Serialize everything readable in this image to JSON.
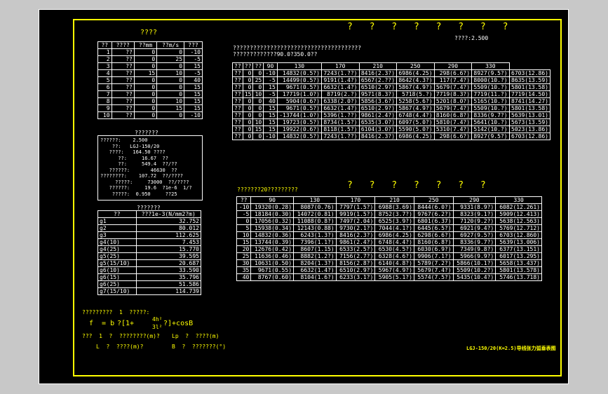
{
  "header": {
    "left_title": "????",
    "main_title": "? ? ? ? ? ? ? ?",
    "safety_note": "????:2.500",
    "subtitle": "??????????????????????????????????????\n?????????????90.0?350.0??",
    "second_title": "? ? ? ? ? ? ?",
    "second_subtitle": "???????20?????????",
    "stamp": "LGJ-150/20(K=2.5)导线张力弧垂表图"
  },
  "conditions_table": {
    "headers": [
      "??",
      "????",
      "??mm",
      "??m/s",
      "???"
    ],
    "rows": [
      [
        "1",
        "??",
        "0",
        "0",
        "-10"
      ],
      [
        "2",
        "??",
        "0",
        "25",
        "-5"
      ],
      [
        "3",
        "??",
        "0",
        "0",
        "15"
      ],
      [
        "4",
        "??",
        "15",
        "10",
        "-5"
      ],
      [
        "5",
        "??",
        "0",
        "0",
        "40"
      ],
      [
        "6",
        "??",
        "0",
        "0",
        "15"
      ],
      [
        "7",
        "??",
        "0",
        "0",
        "15"
      ],
      [
        "8",
        "??",
        "0",
        "10",
        "15"
      ],
      [
        "9",
        "??",
        "0",
        "15",
        "15"
      ],
      [
        "10",
        "??",
        "0",
        "0",
        "-10"
      ]
    ]
  },
  "params_box": {
    "title": "???????",
    "lines": [
      "??????:    2.500",
      "    ??:   LGJ-150/20",
      "   ????:   164.50 ????",
      "      ??:     16.67  ??",
      "      ??:     549.4  ??/??",
      "   ??????:       46630  ??",
      "????????:    107.72  ??/????",
      "     ?????:     73000  ??/????",
      "   ??????:     19.6  ?1e-6  1/?",
      "    ?????:  0.950     ??25"
    ]
  },
  "load_table": {
    "title": "???????",
    "headers": [
      "??",
      "???1e-3(N/mm2?m)"
    ],
    "rows": [
      [
        "g1",
        "32.752"
      ],
      [
        "g2",
        "80.012"
      ],
      [
        "g3",
        "112.625"
      ],
      [
        "g4(10)",
        "7.453"
      ],
      [
        "g4(25)",
        "15.770"
      ],
      [
        "g5(25)",
        "39.595"
      ],
      [
        "g5(15/10)",
        "20.687"
      ],
      [
        "g6(10)",
        "33.590"
      ],
      [
        "g6(15)",
        "35.796"
      ],
      [
        "g6(25)",
        "51.586"
      ],
      [
        "g7(15/10)",
        "114.739"
      ]
    ]
  },
  "tension_table": {
    "headers": [
      "??",
      "??",
      "??",
      "90",
      "130",
      "170",
      "210",
      "250",
      "290",
      "330"
    ],
    "rows": [
      [
        "??",
        "0",
        "0",
        "-10",
        "14832(0.5?)",
        "7243(1.??)",
        "8416(2.3?)",
        "6986(4.25)",
        "298(6.6?)",
        "8927(9.5?)",
        "6703(12.86)"
      ],
      [
        "??",
        "0",
        "25",
        "-5",
        "14499(0.5?)",
        "9191(1.4?)",
        "6567(2.??)",
        "8642(4.3?)",
        "117(7.4?)",
        "8000(10.?)",
        "8635(13.59)"
      ],
      [
        "??",
        "0",
        "0",
        "15",
        "9671(0.5?)",
        "6632(1.4?)",
        "6510(2.9?)",
        "5867(4.9?)",
        "5679(7.4?)",
        "5509(10.?)",
        "5801(13.58)"
      ],
      [
        "??",
        "15",
        "10",
        "-5",
        "17719(1.0?)",
        "8719(2.?)",
        "9571(8.3?)",
        "5718(5.?)",
        "7719(8.3?)",
        "7719(11.?)",
        "7719(14.50)"
      ],
      [
        "??",
        "0",
        "0",
        "40",
        "5904(0.6?)",
        "6338(2.0?)",
        "5856(3.6?)",
        "5258(5.6?)",
        "5201(8.0?)",
        "5165(10.?)",
        "8741(14.27)"
      ],
      [
        "??",
        "0",
        "0",
        "15",
        "9671(0.5?)",
        "6632(1.4?)",
        "6510(2.9?)",
        "5867(4.9?)",
        "5679(7.4?)",
        "5509(10.?)",
        "5801(13.58)"
      ],
      [
        "??",
        "0",
        "0",
        "15",
        "-13744(1.0?)",
        "5396(1.??)",
        "9861(2.4?)",
        "6748(4.4?)",
        "8160(6.8?)",
        "8336(9.7?)",
        "5639(13.01)"
      ],
      [
        "??",
        "0",
        "10",
        "15",
        "19723(0.5?)",
        "8734(1.5?)",
        "6535(3.0?)",
        "6097(5.0?)",
        "5810(7.4?)",
        "5641(10.?)",
        "5673(13.59)"
      ],
      [
        "??",
        "0",
        "15",
        "15",
        "19922(0.6?)",
        "8118(1.5?)",
        "6104(3.0?)",
        "5590(5.0?)",
        "5310(7.4?)",
        "5142(10.?)",
        "5023(13.86)"
      ],
      [
        "??",
        "0",
        "0",
        "-10",
        "14832(0.5?)",
        "7243(1.??)",
        "8416(2.3?)",
        "6986(4.25)",
        "298(6.6?)",
        "8927(9.5?)",
        "6703(12.86)"
      ]
    ]
  },
  "stringing_table": {
    "headers": [
      "??",
      "90",
      "130",
      "170",
      "210",
      "250",
      "290",
      "330"
    ],
    "rows": [
      [
        "-10",
        "19320(0.28)",
        "8087(0.76)",
        "7797(1.5?)",
        "6988(3.69)",
        "8444(6.0?)",
        "9331(8.9?)",
        "6082(12.261)"
      ],
      [
        "-5",
        "18184(0.30)",
        "14072(0.81)",
        "9919(1.5?)",
        "8752(3.7?)",
        "9767(6.2?)",
        "8323(9.1?)",
        "5909(12.413)"
      ],
      [
        "0",
        "17056(0.32)",
        "11088(0.8?)",
        "7497(2.04)",
        "6525(3.9?)",
        "6801(6.37)",
        "7120(9.2?)",
        "5638(12.563)"
      ],
      [
        "5",
        "15938(0.34)",
        "12143(0.88)",
        "9730(2.1?)",
        "7044(4.1?)",
        "6445(6.5?)",
        "6921(9.4?)",
        "5769(12.712)"
      ],
      [
        "10",
        "14832(0.36)",
        "6243(1.3?)",
        "8416(2.3?)",
        "6986(4.25)",
        "6298(6.6?)",
        "6927(9.5?)",
        "6703(12.860)"
      ],
      [
        "15",
        "13744(0.39)",
        "7396(1.1?)",
        "9861(2.4?)",
        "6748(4.4?)",
        "8160(6.8?)",
        "8336(9.7?)",
        "5639(13.006)"
      ],
      [
        "20",
        "12676(0.42)",
        "8607(1.15)",
        "6533(2.5?)",
        "6530(4.5?)",
        "6030(6.9?)",
        "7349(9.8?)",
        "6377(13.151)"
      ],
      [
        "25",
        "11636(0.46)",
        "8882(1.2?)",
        "7156(2.7?)",
        "6328(4.6?)",
        "9906(7.1?)",
        "5966(9.9?)",
        "6017(13.295)"
      ],
      [
        "30",
        "10631(0.50)",
        "8204(1.3?)",
        "8156(2.8?)",
        "6140(4.8?)",
        "5789(7.2?)",
        "5866(10.1?)",
        "5658(13.437)"
      ],
      [
        "35",
        "9671(0.55)",
        "6632(1.4?)",
        "6510(2.9?)",
        "5967(4.9?)",
        "5679(7.4?)",
        "5509(10.2?)",
        "5801(13.578)"
      ],
      [
        "40",
        "8767(0.60)",
        "8104(1.6?)",
        "6233(3.1?)",
        "5905(5.1?)",
        "5574(7.5?)",
        "5435(10.4?)",
        "5746(13.718)"
      ]
    ]
  },
  "formula": {
    "line1": "?????????  1  ?????:",
    "lhs": "f  = b",
    "frac_top": "4h²",
    "bracket": "?[1+",
    "frac2": "3l²",
    "rhs": "?]+cosB",
    "def1": "???  1  ?  ????????(m)?",
    "def2": "Lp  ?  ????(m)",
    "def3": "L  ?  ????(m)?",
    "def4": "B  ?  ???????(°)"
  }
}
